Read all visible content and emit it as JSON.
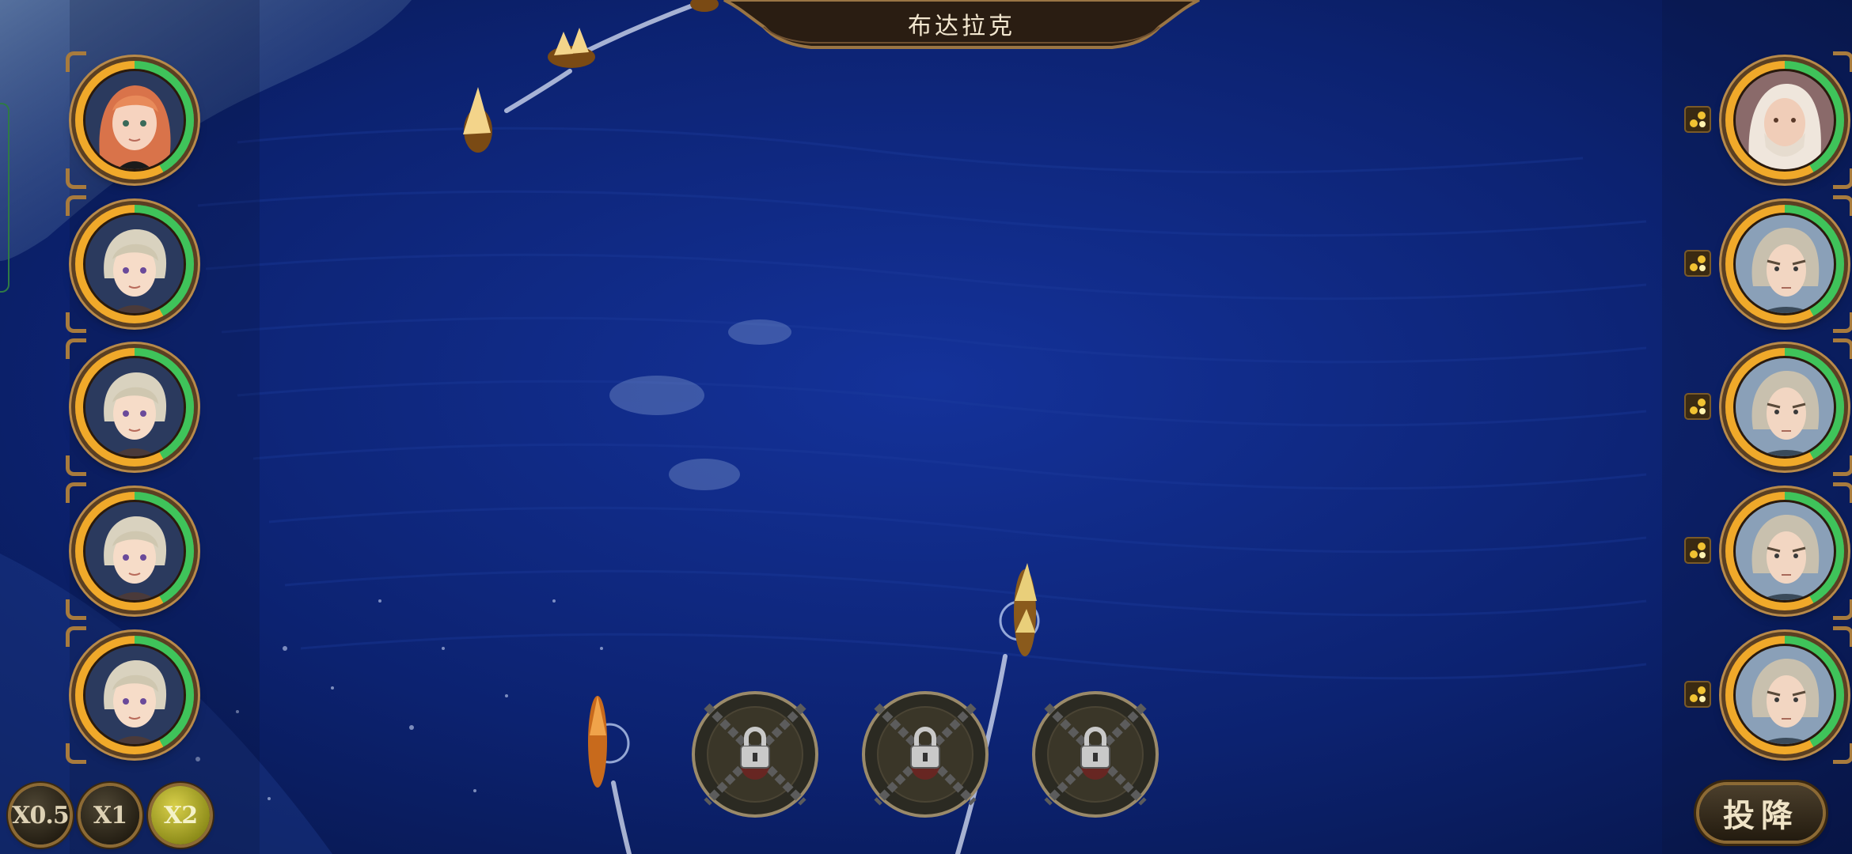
{
  "header": {
    "location_name": "布达拉克"
  },
  "left_fleet": [
    {
      "id": "captain-1",
      "character": "red-haired-woman",
      "hp_fraction": 0.42
    },
    {
      "id": "captain-2",
      "character": "silver-haired-man",
      "hp_fraction": 0.42
    },
    {
      "id": "captain-3",
      "character": "silver-haired-man",
      "hp_fraction": 0.42
    },
    {
      "id": "captain-4",
      "character": "silver-haired-man",
      "hp_fraction": 0.42
    },
    {
      "id": "captain-5",
      "character": "silver-haired-man",
      "hp_fraction": 0.42
    }
  ],
  "right_fleet": [
    {
      "id": "enemy-1",
      "character": "white-haired-elder",
      "hp_fraction": 0.42
    },
    {
      "id": "enemy-2",
      "character": "grey-haired-man",
      "hp_fraction": 0.42
    },
    {
      "id": "enemy-3",
      "character": "grey-haired-man",
      "hp_fraction": 0.42
    },
    {
      "id": "enemy-4",
      "character": "grey-haired-man",
      "hp_fraction": 0.42
    },
    {
      "id": "enemy-5",
      "character": "grey-haired-man",
      "hp_fraction": 0.42
    }
  ],
  "skills": [
    {
      "id": "skill-1",
      "state": "locked",
      "icon": "lock-icon"
    },
    {
      "id": "skill-2",
      "state": "locked",
      "icon": "lock-icon"
    },
    {
      "id": "skill-3",
      "state": "locked",
      "icon": "lock-icon"
    }
  ],
  "speed_controls": {
    "options": [
      "X0.5",
      "X1",
      "X2"
    ],
    "selected": "X2"
  },
  "surrender": {
    "label": "投降"
  },
  "colors": {
    "hp_bar": "#3fc35a",
    "portrait_ring": "#f0a92a",
    "speed_active": "#c9c23a",
    "ocean": "#0c2268"
  }
}
